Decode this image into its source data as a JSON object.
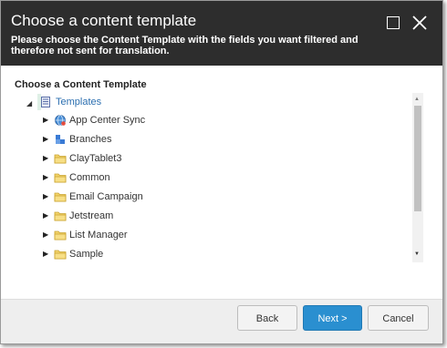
{
  "dialog": {
    "title": "Choose a content template",
    "subtitle": "Please choose the Content Template with the fields you want filtered and therefore not sent for translation."
  },
  "tree": {
    "section_label": "Choose a Content Template",
    "root": {
      "label": "Templates",
      "icon": "templates-folder-icon",
      "expanded": true,
      "selected": true
    },
    "items": [
      {
        "label": "App Center Sync",
        "icon": "globe-icon"
      },
      {
        "label": "Branches",
        "icon": "branches-icon"
      },
      {
        "label": "ClayTablet3",
        "icon": "folder-icon"
      },
      {
        "label": "Common",
        "icon": "folder-icon"
      },
      {
        "label": "Email Campaign",
        "icon": "folder-icon"
      },
      {
        "label": "Jetstream",
        "icon": "folder-icon"
      },
      {
        "label": "List Manager",
        "icon": "folder-icon"
      },
      {
        "label": "Sample",
        "icon": "folder-icon"
      }
    ]
  },
  "footer": {
    "back_label": "Back",
    "next_label": "Next >",
    "cancel_label": "Cancel"
  },
  "colors": {
    "titlebar": "#2d2d2d",
    "primary_button": "#2a8fd0",
    "selected_row": "#dff0e6",
    "link_text": "#2c6fb0"
  }
}
